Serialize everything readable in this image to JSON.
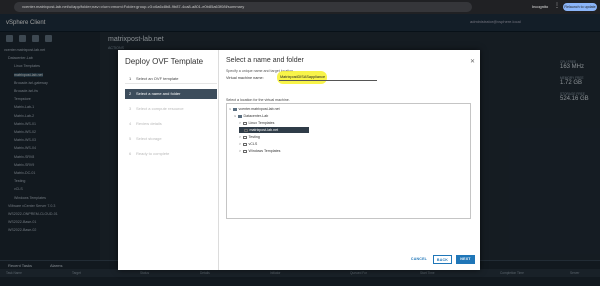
{
  "browser": {
    "url": "vcenter.matrixpost-lab.net/ui/app/folder;nav=v/urn:vmomi:Folder:group-v3:c6a6c8b8-9b87-4ca8-a801-e0b85a63f08f/summary",
    "incognito": "Incognito",
    "relaunch": "Relaunch to update"
  },
  "app": {
    "title": "vSphere Client",
    "user": "administrator@vsphere.local",
    "vm_title": "matrixpost-lab.net",
    "vm_actions": "ACTIONS"
  },
  "tree": [
    "vcenter.matrixpost-lab.net",
    "Datacenter-Lab",
    "Linux Templates",
    "matrixpost-lab.net",
    "Brocade-isrl-gateway",
    "Brocade-isrl-fw",
    "Tempstore",
    "Matrix-Lab-1",
    "Matrix-Lab-2",
    "Matrix-WS-01",
    "Matrix-WS-02",
    "Matrix-WS-03",
    "Matrix-WS-04",
    "Matrix-SRV8",
    "Matrix-SRV9",
    "Matrix-DC-01",
    "Testing",
    "vCLS",
    "Windows Templates",
    "VMware vCenter Server 7.0.3",
    "WS2022-ONPREM-CLOUD-01",
    "WS2022-Base-01",
    "WS2022-Base-02"
  ],
  "stats": [
    {
      "label": "CPU FREE",
      "value": "163 MHz"
    },
    {
      "label": "MEMORY FREE",
      "value": "1.72 GB"
    },
    {
      "label": "STORAGE FREE",
      "value": "524.16 GB"
    }
  ],
  "bottom": {
    "tabs": [
      "Recent Tasks",
      "Alarms"
    ],
    "columns": [
      "Task Name",
      "Target",
      "Status",
      "Details",
      "Initiator",
      "Queued For",
      "Start Time",
      "Completion Time",
      "Server"
    ]
  },
  "dialog": {
    "wizard_title": "Deploy OVF Template",
    "steps": [
      {
        "num": "1",
        "label": "Select an OVF template",
        "state": "done"
      },
      {
        "num": "2",
        "label": "Select a name and folder",
        "state": "active"
      },
      {
        "num": "3",
        "label": "Select a compute resource",
        "state": "pending"
      },
      {
        "num": "4",
        "label": "Review details",
        "state": "pending"
      },
      {
        "num": "5",
        "label": "Select storage",
        "state": "pending"
      },
      {
        "num": "6",
        "label": "Ready to complete",
        "state": "pending"
      }
    ],
    "content_title": "Select a name and folder",
    "close": "✕",
    "hint": "Specify a unique name and target location",
    "vm_name_label": "Virtual machine name:",
    "vm_name_value": "MatrixpostDISASappliance",
    "location_label": "Select a location for the virtual machine.",
    "tree": [
      {
        "label": "vcenter.matrixpost-lab.net",
        "indent": 0,
        "caret": "∨",
        "icon": "vc"
      },
      {
        "label": "Datacenter-Lab",
        "indent": 1,
        "caret": "∨",
        "icon": "dc"
      },
      {
        "label": "Linux Templates",
        "indent": 2,
        "caret": ">",
        "icon": "folder"
      },
      {
        "label": "matrixpost-lab.net",
        "indent": 2,
        "caret": "",
        "icon": "folder",
        "selected": true
      },
      {
        "label": "Testing",
        "indent": 2,
        "caret": ">",
        "icon": "folder"
      },
      {
        "label": "vCLS",
        "indent": 2,
        "caret": ">",
        "icon": "folder"
      },
      {
        "label": "Windows Templates",
        "indent": 2,
        "caret": ">",
        "icon": "folder"
      }
    ],
    "buttons": {
      "cancel": "CANCEL",
      "back": "BACK",
      "next": "NEXT"
    }
  }
}
